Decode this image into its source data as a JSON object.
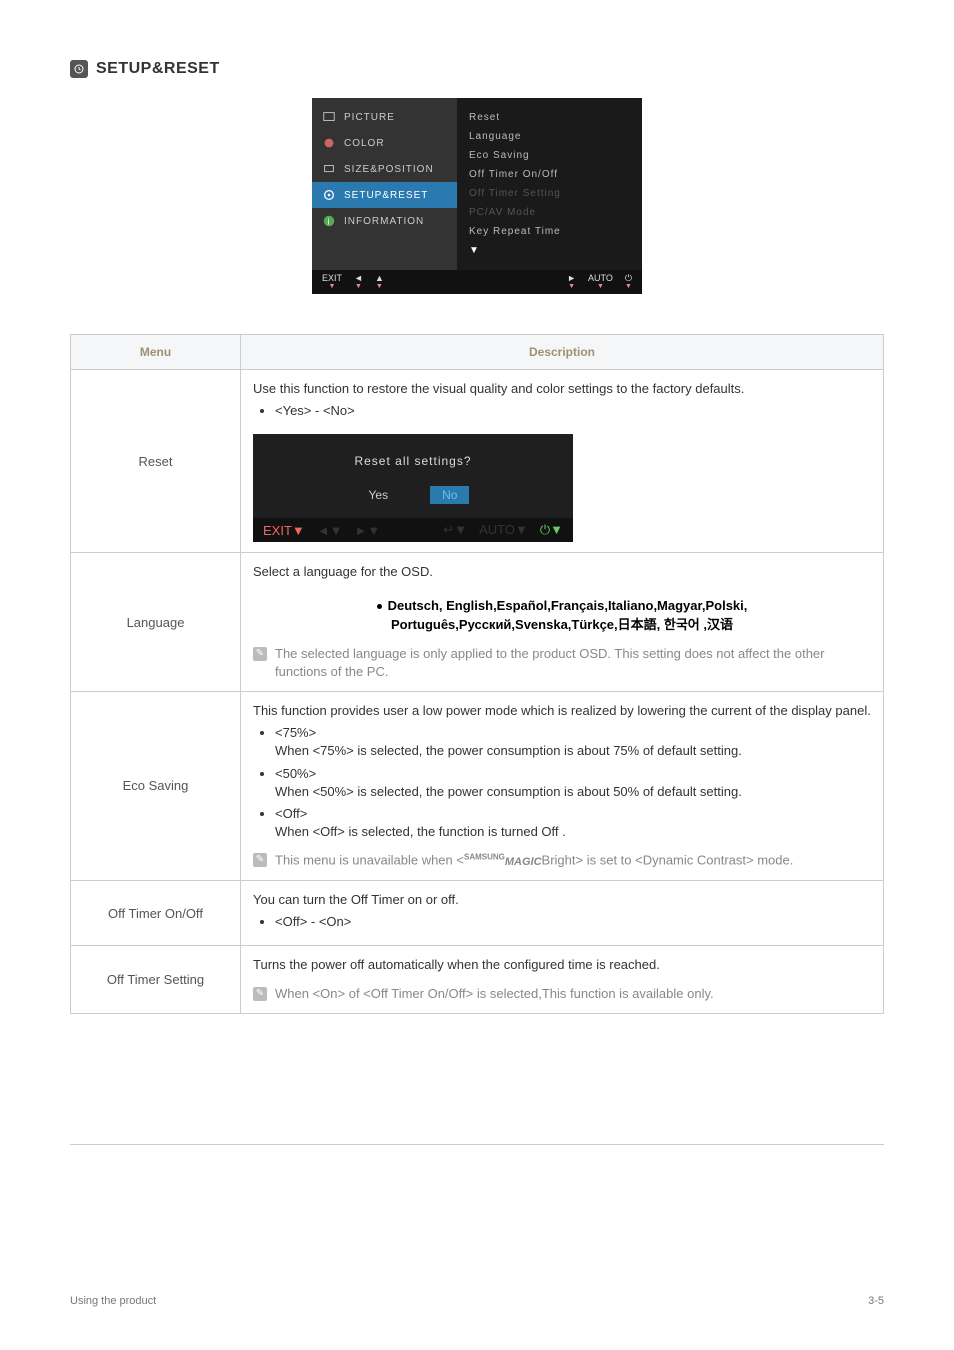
{
  "section": {
    "title": "SETUP&RESET"
  },
  "osd": {
    "left": [
      {
        "label": "PICTURE",
        "icon": "picture"
      },
      {
        "label": "COLOR",
        "icon": "color"
      },
      {
        "label": "SIZE&POSITION",
        "icon": "size"
      },
      {
        "label": "SETUP&RESET",
        "icon": "setup",
        "selected": true
      },
      {
        "label": "INFORMATION",
        "icon": "info"
      }
    ],
    "right": [
      {
        "label": "Reset"
      },
      {
        "label": "Language"
      },
      {
        "label": "Eco Saving"
      },
      {
        "label": "Off Timer On/Off"
      },
      {
        "label": "Off Timer Setting",
        "dim": true
      },
      {
        "label": "PC/AV Mode",
        "dim": true
      },
      {
        "label": "Key Repeat Time"
      },
      {
        "label": "▼",
        "arrow": true
      }
    ],
    "foot": {
      "left": [
        "EXIT",
        "◄",
        "▲"
      ],
      "right": [
        "►",
        "AUTO",
        "⏻"
      ]
    }
  },
  "headers": {
    "menu": "Menu",
    "desc": "Description"
  },
  "rows": {
    "reset": {
      "name": "Reset",
      "intro": "Use this function to restore the visual quality and color settings to the factory defaults.",
      "opts": "<Yes> - <No>",
      "dialog": {
        "q": "Reset all settings?",
        "yes": "Yes",
        "no": "No"
      }
    },
    "language": {
      "name": "Language",
      "intro": "Select a language for the OSD.",
      "lang_line1": "Deutsch, English,Español,Français,Italiano,Magyar,Polski,",
      "lang_line2": "Português,Русский,Svenska,Türkçe,日本語, 한국어 ,汉语",
      "note": "The selected language is only applied to the product OSD. This setting does not affect the other functions of the PC."
    },
    "eco": {
      "name": "Eco Saving",
      "intro": "This function provides user a low power mode which is realized by lowering the current of the display panel.",
      "o1": "<75%>",
      "o1d": "When <75%> is selected, the power consumption is about 75% of default setting.",
      "o2": "<50%>",
      "o2d": "When <50%> is selected, the power consumption is about 50% of default setting.",
      "o3": "<Off>",
      "o3d": "When <Off> is selected, the function is turned Off .",
      "note_pre": "This menu is unavailable when <",
      "note_post": "Bright> is set to <Dynamic Contrast> mode.",
      "magic_top": "SAMSUNG",
      "magic_bot": "MAGIC"
    },
    "timer_onoff": {
      "name": "Off Timer On/Off",
      "intro": "You can turn the Off Timer on or off.",
      "opts": "<Off> - <On>"
    },
    "timer_set": {
      "name": "Off Timer Setting",
      "intro": "Turns the power off automatically when the configured time is reached.",
      "note": "When <On> of <Off Timer On/Off> is selected,This function is available only."
    }
  },
  "footer": {
    "left": "Using the product",
    "right": "3-5"
  }
}
